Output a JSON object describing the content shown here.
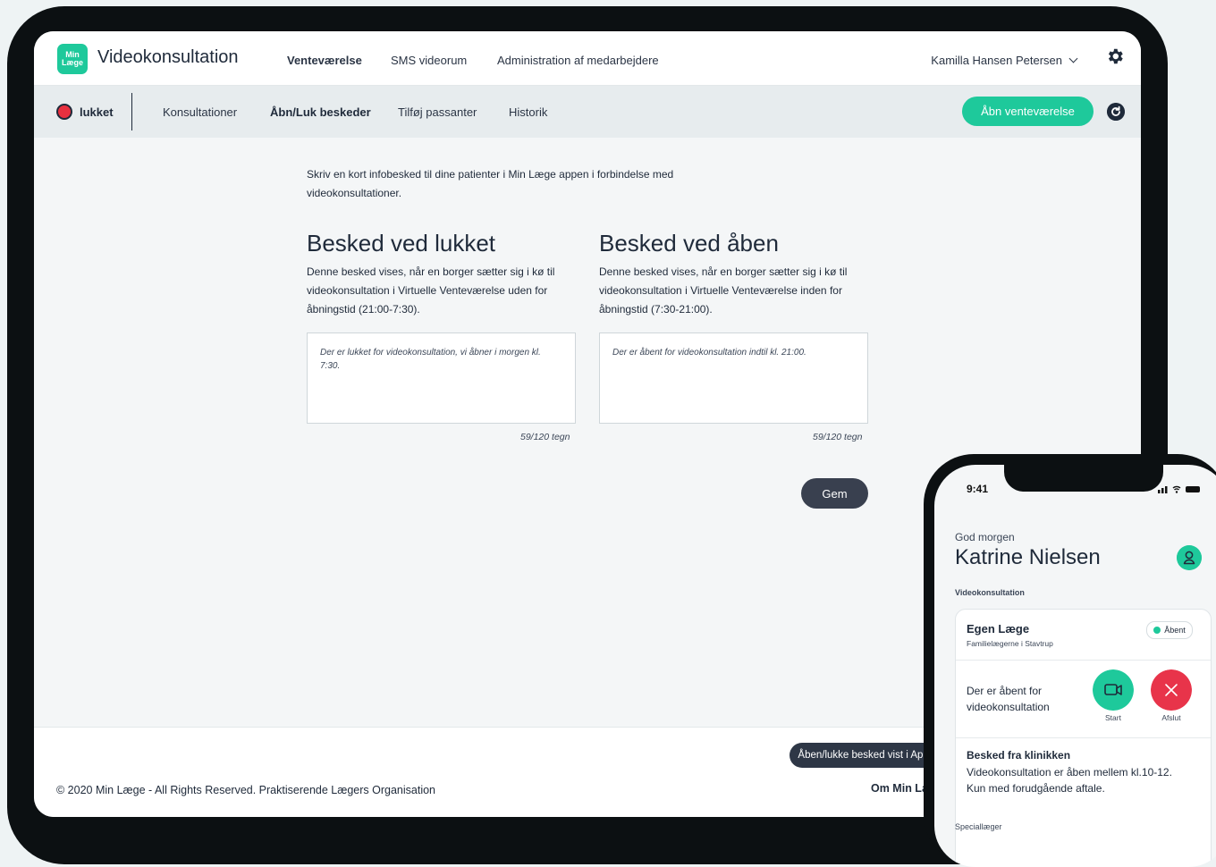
{
  "app": {
    "logo_line1": "Min",
    "logo_line2": "Læge",
    "title": "Videokonsultation"
  },
  "topnav": [
    {
      "label": "Venteværelse",
      "active": true
    },
    {
      "label": "SMS videorum",
      "active": false
    },
    {
      "label": "Administration af medarbejdere",
      "active": false
    }
  ],
  "user": {
    "name": "Kamilla Hansen Petersen"
  },
  "status": {
    "label": "lukket",
    "color": "#e8303f"
  },
  "subnav": [
    {
      "label": "Konsultationer",
      "active": false
    },
    {
      "label": "Åbn/Luk beskeder",
      "active": true
    },
    {
      "label": "Tilføj passanter",
      "active": false
    },
    {
      "label": "Historik",
      "active": false
    }
  ],
  "open_button": "Åbn venteværelse",
  "intro": "Skriv en kort infobesked til dine patienter i Min Læge appen i forbindelse med videokonsultationer.",
  "closed_section": {
    "heading": "Besked ved lukket",
    "description": "Denne besked vises, når en borger sætter sig i kø til videokonsultation i Virtuelle Venteværelse uden for åbningstid (21:00-7:30).",
    "message": "Der er lukket for videokonsultation, vi åbner i morgen kl. 7:30.",
    "counter": "59/120 tegn"
  },
  "open_section": {
    "heading": "Besked ved åben",
    "description": "Denne besked vises, når en borger sætter sig i kø til videokonsultation i Virtuelle Venteværelse inden for åbningstid (7:30-21:00).",
    "message": "Der er åbent for videokonsultation indtil kl. 21:00.",
    "counter": "59/120 tegn"
  },
  "save_button": "Gem",
  "footer": {
    "copyright": "© 2020 Min Læge - All Rights Reserved. Praktiserende Lægers Organisation",
    "link": "Om Min Læge"
  },
  "tooltip": "Åben/lukke besked vist i Appen",
  "phone": {
    "time": "9:41",
    "greeting": "God morgen",
    "name": "Katrine Nielsen",
    "section": "Videokonsultation",
    "card_title": "Egen Læge",
    "card_subtitle": "Familielægerne i Stavtrup",
    "badge": "Åbent",
    "open_text": "Der er åbent for videokonsultation",
    "start_label": "Start",
    "end_label": "Afslut",
    "msg_title": "Besked fra klinikken",
    "msg_text": "Videokonsultation er åben mellem kl.10-12. Kun med forudgående aftale.",
    "next_section": "Speciallæger"
  },
  "colors": {
    "accent": "#1ec99b",
    "closed": "#e8303f",
    "dark": "#39404f"
  }
}
